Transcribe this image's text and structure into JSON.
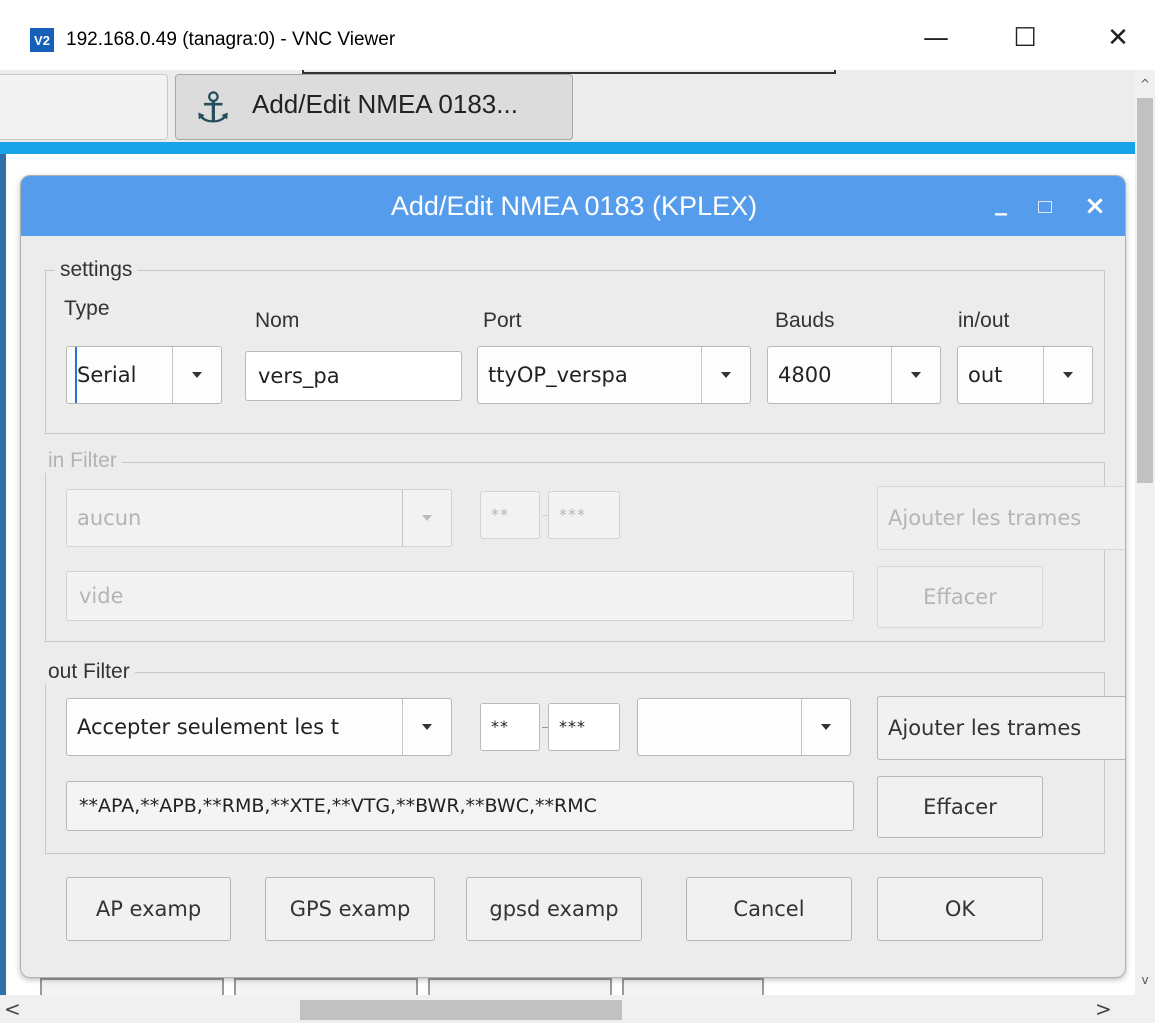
{
  "window": {
    "logo_text": "V2",
    "title": "192.168.0.49 (tanagra:0) - VNC Viewer",
    "minimize_glyph": "—",
    "maximize_glyph": "☐",
    "close_glyph": "✕"
  },
  "taskbar": {
    "active_tab_icon": "anchor-icon",
    "active_tab_label": "Add/Edit NMEA 0183..."
  },
  "dialog": {
    "title": "Add/Edit NMEA 0183 (KPLEX)",
    "title_bar_color": "#559dec",
    "settings": {
      "legend": "settings",
      "type_label": "Type",
      "type_value": "Serial",
      "name_label": "Nom",
      "name_value": "vers_pa",
      "port_label": "Port",
      "port_value": "ttyOP_verspa",
      "bauds_label": "Bauds",
      "bauds_value": "4800",
      "inout_label": "in/out",
      "inout_value": "out"
    },
    "in_filter": {
      "legend": "in Filter",
      "mode_value": "aucun",
      "talker_value": "**",
      "sentence_value": "***",
      "add_button": "Ajouter les trames",
      "list_value": "vide",
      "clear_button": "Effacer"
    },
    "out_filter": {
      "legend": "out Filter",
      "mode_value": "Accepter seulement les t",
      "talker_value": "**",
      "sentence_value": "***",
      "extra_value": "",
      "add_button": "Ajouter les trames",
      "list_value": "**APA,**APB,**RMB,**XTE,**VTG,**BWR,**BWC,**RMC",
      "clear_button": "Effacer"
    },
    "buttons": {
      "ap_example": "AP examp",
      "gps_example": "GPS examp",
      "gpsd_example": "gpsd examp",
      "cancel": "Cancel",
      "ok": "OK"
    }
  },
  "scrollbars": {
    "up_arrow": "^",
    "down_arrow": "v",
    "left_arrow": "<",
    "right_arrow": ">"
  }
}
